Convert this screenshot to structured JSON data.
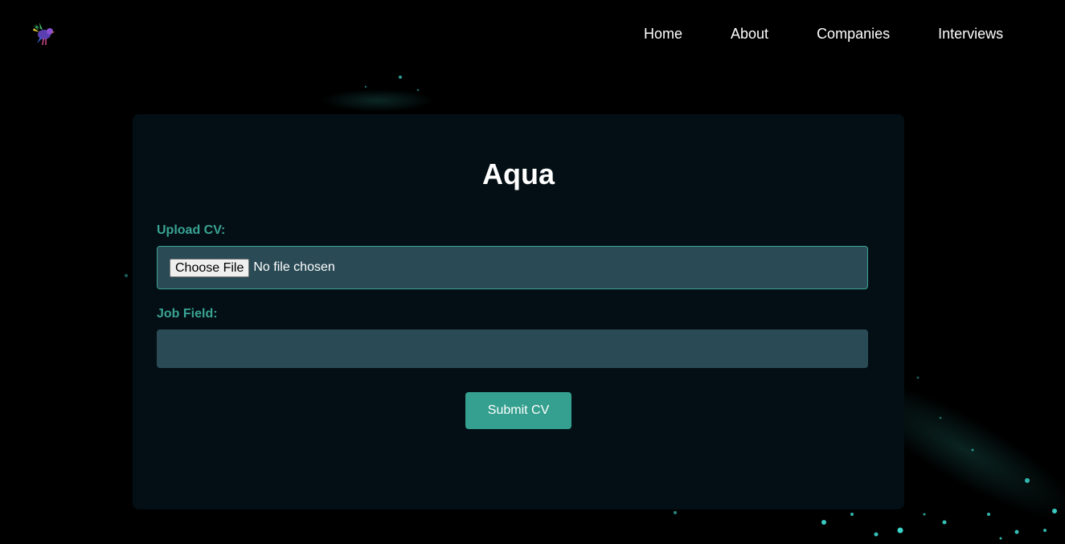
{
  "nav": {
    "items": [
      {
        "label": "Home"
      },
      {
        "label": "About"
      },
      {
        "label": "Companies"
      },
      {
        "label": "Interviews"
      }
    ]
  },
  "logo": {
    "icon": "bird-logo-icon"
  },
  "form": {
    "title": "Aqua",
    "upload_label": "Upload CV:",
    "choose_file_label": "Choose File",
    "file_status": "No file chosen",
    "job_field_label": "Job Field:",
    "job_field_value": "",
    "submit_label": "Submit CV"
  },
  "colors": {
    "background": "#000000",
    "card": "#030f14",
    "accent": "#3aa394",
    "input_bg": "#2a4a55",
    "button": "#35a08f",
    "sparkle": "#3fe0d6"
  }
}
